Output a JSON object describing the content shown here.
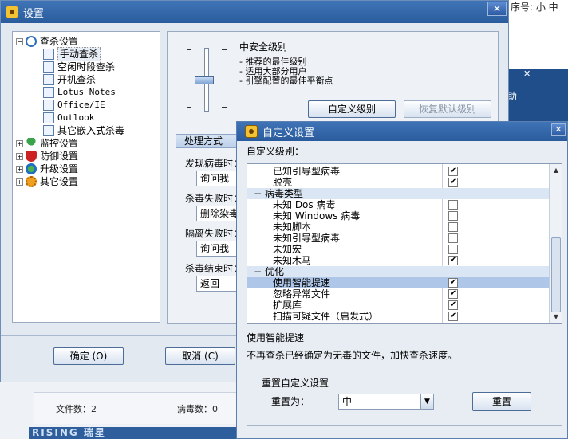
{
  "background": {
    "top_right_text": "序号:  小  中",
    "blue_strip_label": "助",
    "footer_files_label": "文件数：2",
    "footer_virus_label": "病毒数：0",
    "logo_text": "RISING 瑞星"
  },
  "settings_window": {
    "title": "设置",
    "tree": {
      "scan_settings": "查杀设置",
      "items": [
        "手动查杀",
        "空闲时段查杀",
        "开机查杀",
        "Lotus Notes",
        "Office/IE",
        "Outlook",
        "其它嵌入式杀毒"
      ],
      "monitor_settings": "监控设置",
      "defense_settings": "防御设置",
      "upgrade_settings": "升级设置",
      "other_settings": "其它设置"
    },
    "level_title": "中安全级别",
    "level_desc": [
      "- 推荐的最佳级别",
      "- 适用大部分用户",
      "- 引擎配置的最佳平衡点"
    ],
    "custom_level_button": "自定义级别",
    "restore_default_button": "恢复默认级别",
    "handling_group": "处理方式",
    "found_virus_label": "发现病毒时：",
    "found_virus_value": "询问我",
    "kill_fail_label": "杀毒失败时：",
    "kill_fail_value": "删除染毒",
    "isolate_fail_label": "隔离失败时：",
    "isolate_fail_value": "询问我",
    "kill_end_label": "杀毒结束时：",
    "kill_end_value": "返回",
    "ok_button": "确定 (O)",
    "cancel_button": "取消 (C)"
  },
  "custom_dialog": {
    "title": "自定义设置",
    "custom_level_label": "自定义级别：",
    "rows": [
      {
        "type": "item",
        "name": "已知引导型病毒",
        "checked": true
      },
      {
        "type": "item",
        "name": "脱壳",
        "checked": true
      },
      {
        "type": "cat",
        "name": "病毒类型"
      },
      {
        "type": "item",
        "name": "未知 Dos 病毒",
        "checked": false
      },
      {
        "type": "item",
        "name": "未知 Windows 病毒",
        "checked": false
      },
      {
        "type": "item",
        "name": "未知脚本",
        "checked": false
      },
      {
        "type": "item",
        "name": "未知引导型病毒",
        "checked": false
      },
      {
        "type": "item",
        "name": "未知宏",
        "checked": false
      },
      {
        "type": "item",
        "name": "未知木马",
        "checked": true
      },
      {
        "type": "cat",
        "name": "优化"
      },
      {
        "type": "item",
        "name": "使用智能提速",
        "checked": true,
        "highlight": true
      },
      {
        "type": "item",
        "name": "忽略异常文件",
        "checked": true
      },
      {
        "type": "item",
        "name": "扩展库",
        "checked": true
      },
      {
        "type": "item",
        "name": "扫描可疑文件（启发式）",
        "checked": true
      }
    ],
    "desc_title": "使用智能提速",
    "desc_text": "不再查杀已经确定为无毒的文件，加快查杀速度。",
    "reset_group_title": "重置自定义设置",
    "reset_to_label": "重置为：",
    "reset_to_value": "中",
    "reset_button": "重置"
  }
}
